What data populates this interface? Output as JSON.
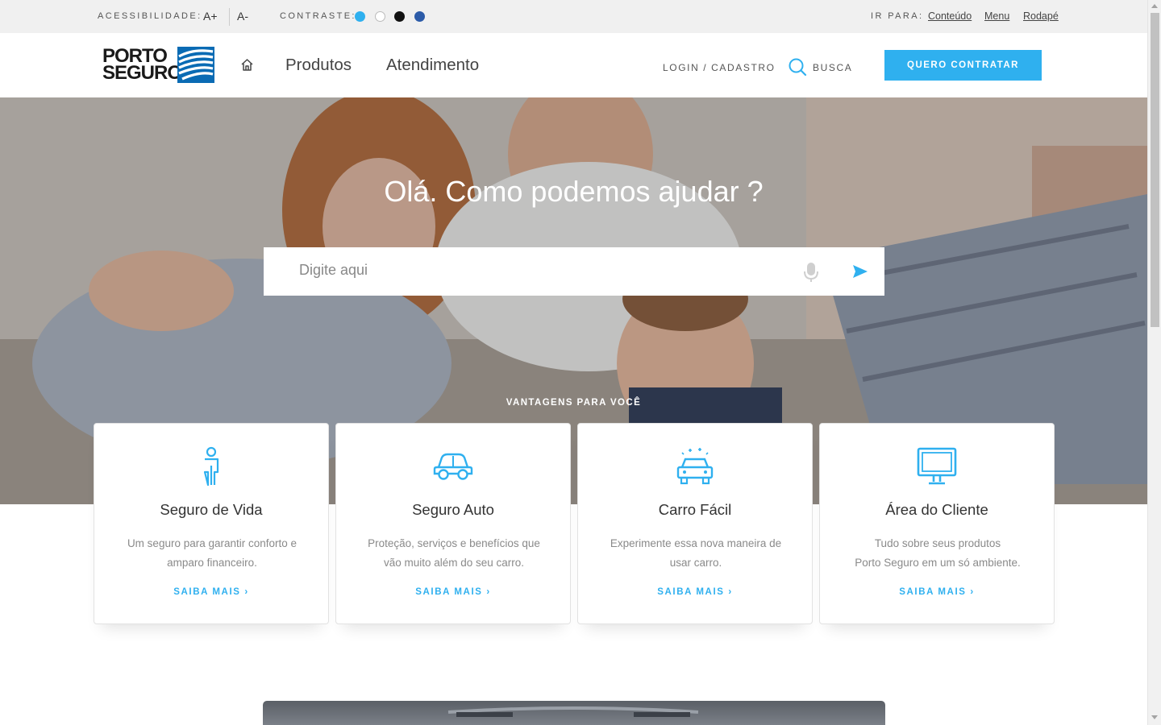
{
  "accessibility_bar": {
    "acessibilidade_label": "ACESSIBILIDADE:",
    "font_increase": "A+",
    "font_decrease": "A-",
    "contraste_label": "CONTRASTE:",
    "contrast_options": [
      "#2fb0ef",
      "#ffffff",
      "#111111",
      "#2c5ba8"
    ],
    "ir_para_label": "IR PARA:",
    "skip_links": [
      "Conteúdo",
      "Menu",
      "Rodapé"
    ]
  },
  "header": {
    "logo_line1": "PORTO",
    "logo_line2": "SEGURO",
    "nav": [
      "Produtos",
      "Atendimento"
    ],
    "login": "LOGIN / CADASTRO",
    "busca": "BUSCA",
    "cta": "QUERO CONTRATAR"
  },
  "hero": {
    "title": "Olá. Como podemos ajudar ?",
    "search_placeholder": "Digite aqui",
    "vantagens": "VANTAGENS PARA VOCÊ"
  },
  "cards": [
    {
      "icon": "person-icon",
      "title": "Seguro de Vida",
      "desc1": "Um seguro para garantir conforto e",
      "desc2": "amparo financeiro.",
      "link": "SAIBA MAIS"
    },
    {
      "icon": "car-icon",
      "title": "Seguro Auto",
      "desc1": "Proteção, serviços e benefícios que",
      "desc2": "vão muito além do seu carro.",
      "link": "SAIBA MAIS"
    },
    {
      "icon": "sparkling-car-icon",
      "title": "Carro Fácil",
      "desc1": "Experimente essa nova maneira de",
      "desc2": "usar carro.",
      "link": "SAIBA MAIS"
    },
    {
      "icon": "monitor-icon",
      "title": "Área do Cliente",
      "desc1": "Tudo sobre seus produtos",
      "desc2": "Porto Seguro em um só ambiente.",
      "link": "SAIBA MAIS"
    }
  ],
  "colors": {
    "accent": "#2fb0ef",
    "brand_blue": "#0a6bb4"
  }
}
